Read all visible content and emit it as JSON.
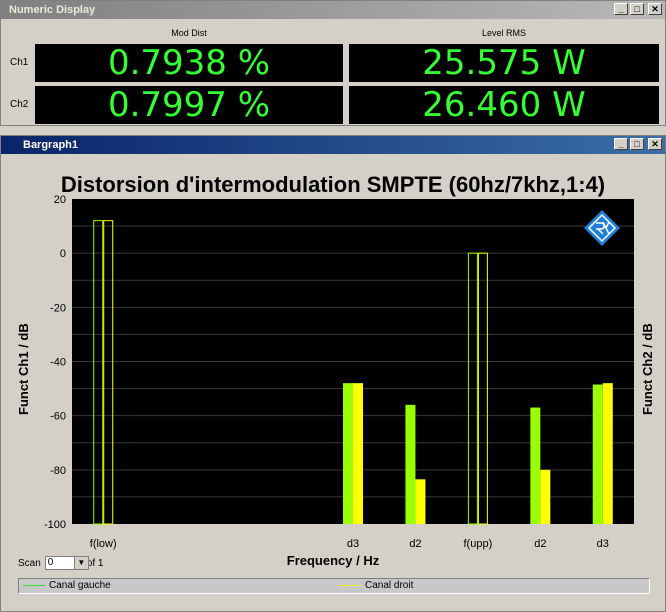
{
  "numeric_window": {
    "title": "Numeric Display",
    "columns": [
      "Mod Dist",
      "Level RMS"
    ],
    "rows": [
      {
        "label": "Ch1",
        "values": [
          "0.7938 %",
          "25.575 W"
        ]
      },
      {
        "label": "Ch2",
        "values": [
          "0.7997 %",
          "26.460 W"
        ]
      }
    ]
  },
  "bargraph_window": {
    "title": "Bargraph1",
    "scan_label": "Scan",
    "scan_value": "0",
    "scan_of": "of 1",
    "legend": [
      {
        "label": "Canal gauche",
        "color": "#33dd33"
      },
      {
        "label": "Canal droit",
        "color": "#eeee22"
      }
    ]
  },
  "window_buttons": {
    "minimize": "_",
    "maximize": "□",
    "close": "✕"
  },
  "colors": {
    "bar_left": "#99ff00",
    "bar_right": "#ffff00",
    "plot_bg": "#000000",
    "digits": "#33ff33"
  },
  "chart_data": {
    "type": "bar",
    "title": "Distorsion d'intermodulation SMPTE (60hz/7khz,1:4)",
    "xlabel": "Frequency / Hz",
    "ylabel": "Funct Ch1 / dB",
    "ylabel_right": "Funct Ch2 / dB",
    "ylim": [
      -100,
      20
    ],
    "yticks": [
      20,
      0,
      -20,
      -40,
      -60,
      -80,
      -100
    ],
    "categories": [
      "f(low)",
      "",
      "",
      "",
      "d3",
      "d2",
      "f(upp)",
      "d2",
      "d3"
    ],
    "series": [
      {
        "name": "Canal gauche",
        "values": [
          12,
          null,
          null,
          null,
          -48,
          -56,
          0,
          -57,
          -48.5
        ],
        "outline": [
          true,
          false,
          false,
          false,
          false,
          false,
          true,
          false,
          false
        ]
      },
      {
        "name": "Canal droit",
        "values": [
          12,
          null,
          null,
          null,
          -48,
          -83.5,
          0,
          -80,
          -48
        ],
        "outline": [
          true,
          false,
          false,
          false,
          false,
          false,
          true,
          false,
          false
        ]
      }
    ],
    "grid": true
  }
}
